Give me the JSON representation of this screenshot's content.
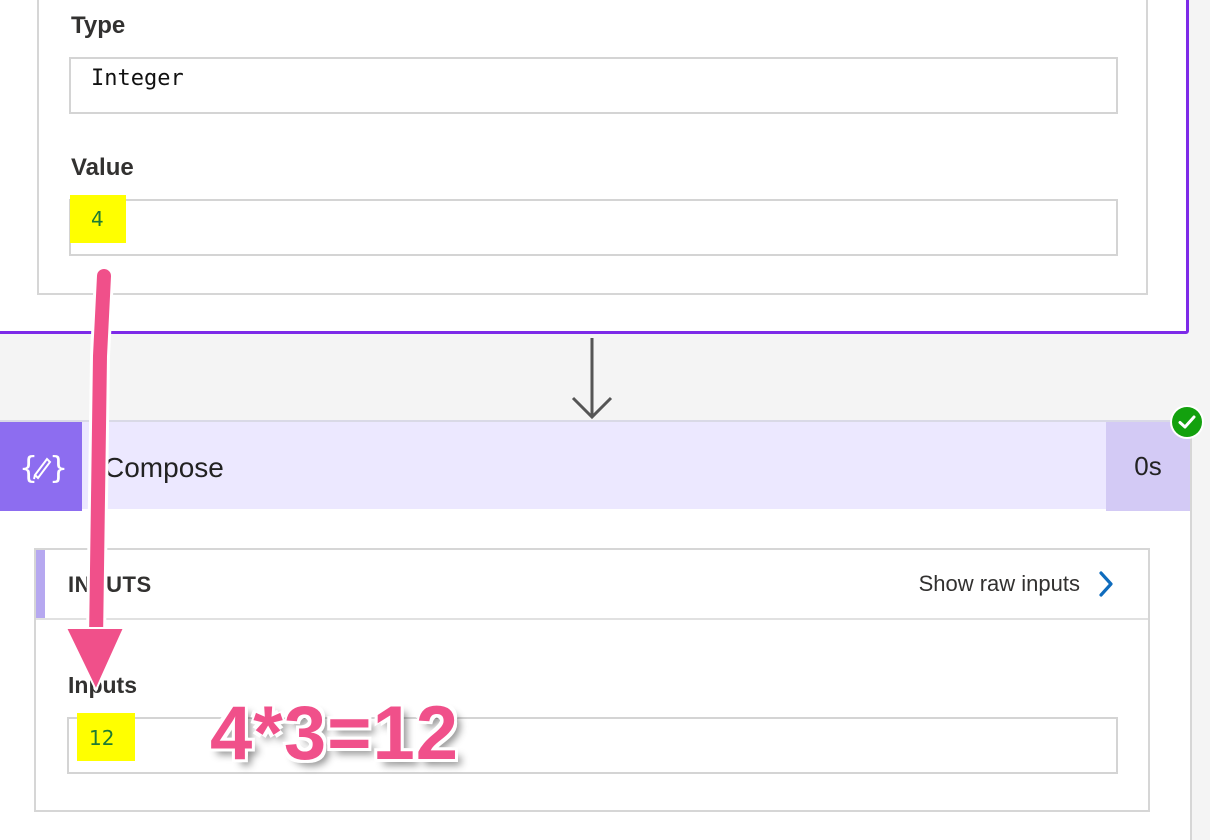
{
  "variable_card": {
    "type_label": "Type",
    "type_value": "Integer",
    "value_label": "Value",
    "value": "4"
  },
  "compose": {
    "title": "Compose",
    "duration": "0s",
    "status_icon": "check-circle-icon",
    "action_icon": "compose-curly-pencil-icon",
    "inputs_section": {
      "heading": "INPUTS",
      "show_raw_link": "Show raw inputs",
      "field_label": "Inputs",
      "field_value": "12"
    }
  },
  "annotation": {
    "formula": "4*3=12",
    "color": "#f0508a"
  },
  "colors": {
    "card_border": "#7d2ae8",
    "compose_icon_bg": "#8d6df0",
    "compose_header_bg": "#ece8ff",
    "highlight": "#ffff00",
    "success": "#13a10e",
    "link_chevron": "#0f6cbd"
  }
}
